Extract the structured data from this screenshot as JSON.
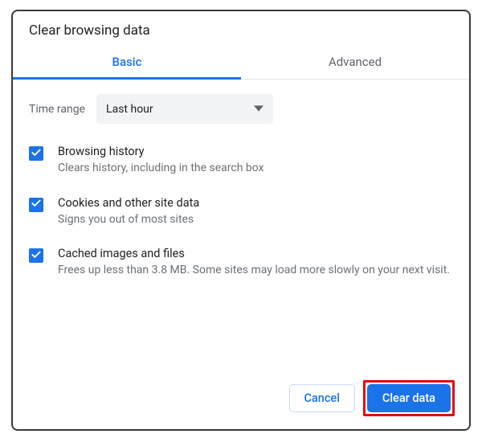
{
  "dialog": {
    "title": "Clear browsing data"
  },
  "tabs": {
    "basic": "Basic",
    "advanced": "Advanced",
    "active": "basic"
  },
  "timerange": {
    "label": "Time range",
    "value": "Last hour"
  },
  "options": [
    {
      "checked": true,
      "title": "Browsing history",
      "desc": "Clears history, including in the search box"
    },
    {
      "checked": true,
      "title": "Cookies and other site data",
      "desc": "Signs you out of most sites"
    },
    {
      "checked": true,
      "title": "Cached images and files",
      "desc": "Frees up less than 3.8 MB. Some sites may load more slowly on your next visit."
    }
  ],
  "buttons": {
    "cancel": "Cancel",
    "clear": "Clear data"
  },
  "colors": {
    "accent": "#1a73e8",
    "highlight": "#e30613"
  }
}
